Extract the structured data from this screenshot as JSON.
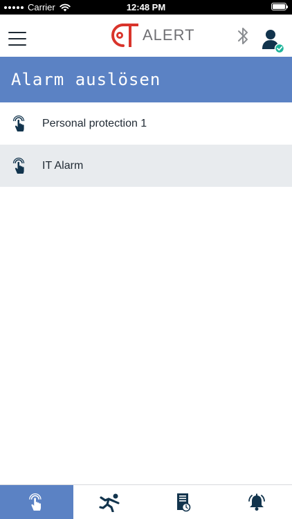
{
  "status_bar": {
    "carrier": "Carrier",
    "time": "12:48 PM",
    "icons": [
      "signal-dots-icon",
      "wifi-icon",
      "battery-icon"
    ]
  },
  "header": {
    "logo_word": "ALERT",
    "icons": [
      "menu-icon",
      "bluetooth-icon",
      "user-verified-icon"
    ]
  },
  "banner": {
    "title": "Alarm auslösen"
  },
  "alarms": [
    {
      "label": "Personal protection 1",
      "icon": "touch-hand-icon"
    },
    {
      "label": "IT Alarm",
      "icon": "touch-hand-icon"
    }
  ],
  "tabbar": {
    "tabs": [
      {
        "icon": "touch-hand-icon",
        "active": true
      },
      {
        "icon": "falling-person-icon",
        "active": false
      },
      {
        "icon": "log-clock-icon",
        "active": false
      },
      {
        "icon": "alarm-bell-icon",
        "active": false
      }
    ]
  },
  "colors": {
    "accent": "#5b82c4",
    "logo_red": "#d9342b",
    "logo_gray": "#6f6f73",
    "verified_green": "#1fb59b",
    "row_alt": "#e8ebee"
  }
}
